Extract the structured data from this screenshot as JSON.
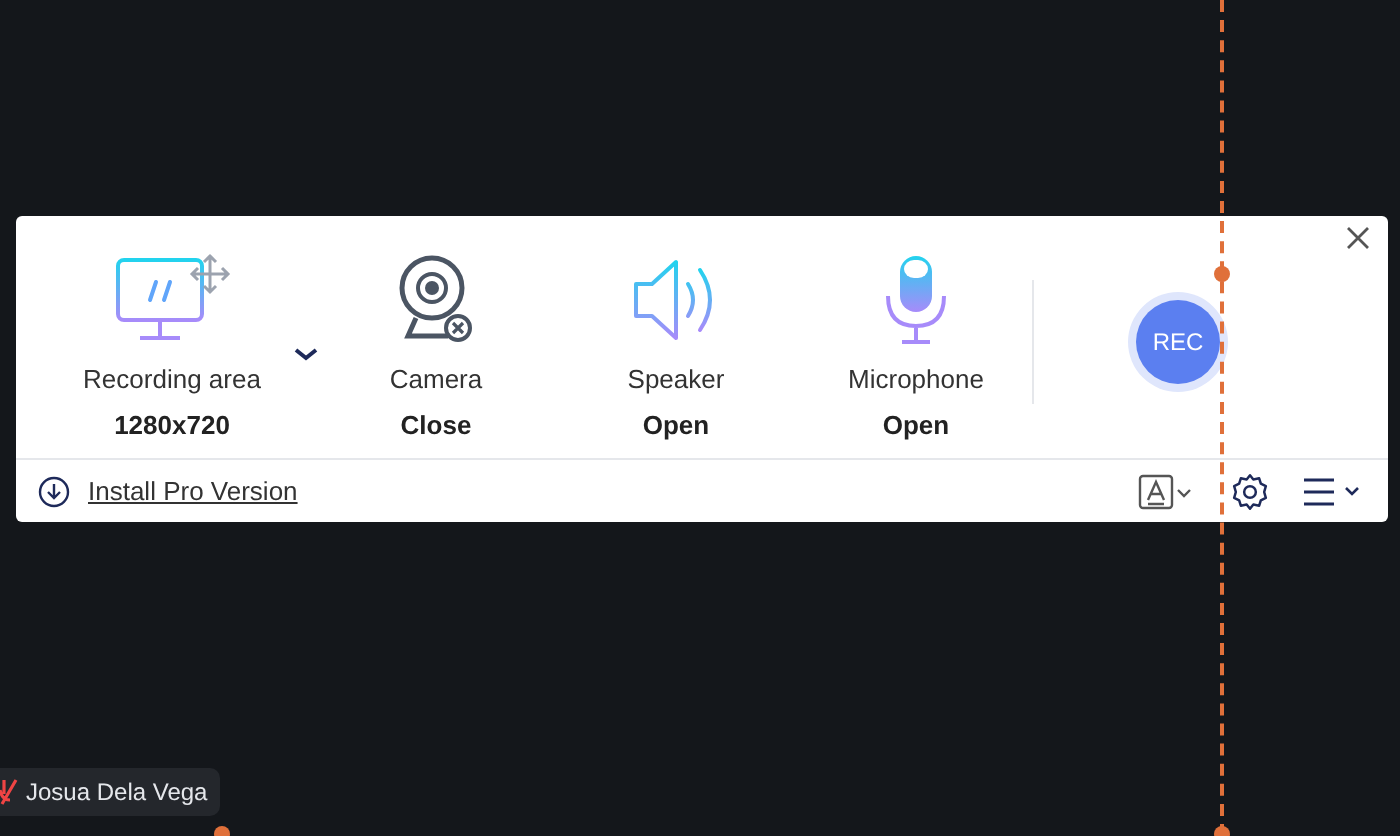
{
  "devices": [
    {
      "kind": "area",
      "label": "Recording area",
      "value": "1280x720"
    },
    {
      "kind": "camera",
      "label": "Camera",
      "value": "Close"
    },
    {
      "kind": "speaker",
      "label": "Speaker",
      "value": "Open"
    },
    {
      "kind": "microphone",
      "label": "Microphone",
      "value": "Open"
    }
  ],
  "record_button": "REC",
  "install_link": "Install Pro Version",
  "participant": {
    "name": "Josua Dela Vega",
    "muted": true
  }
}
